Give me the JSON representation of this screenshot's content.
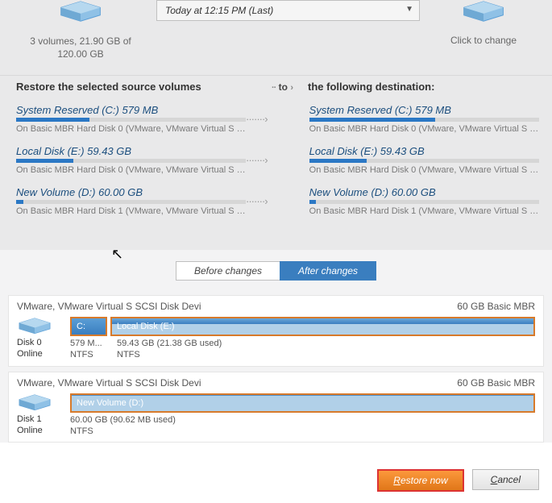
{
  "top": {
    "source_summary": "3 volumes, 21.90 GB of 120.00 GB",
    "snapshot_label": "Today at 12:15 PM (Last)",
    "dest_label": "Click to change"
  },
  "mapping": {
    "left_title": "Restore the selected source volumes",
    "mid_label": "to",
    "right_title": "the following destination:",
    "rows": [
      {
        "title": "System Reserved (C:) 579 MB",
        "sub": "On Basic MBR Hard Disk 0 (VMware, VMware Virtual S SCSI Di...",
        "fill": 32,
        "r_title": "System Reserved (C:) 579 MB",
        "r_sub": "On Basic MBR Hard Disk 0 (VMware, VMware Virtual S SCSI Di...",
        "r_fill": 55
      },
      {
        "title": "Local Disk (E:) 59.43 GB",
        "sub": "On Basic MBR Hard Disk 0 (VMware, VMware Virtual S SCSI Di...",
        "fill": 25,
        "r_title": "Local Disk (E:) 59.43 GB",
        "r_sub": "On Basic MBR Hard Disk 0 (VMware, VMware Virtual S SCSI Di...",
        "r_fill": 25
      },
      {
        "title": "New Volume (D:) 60.00 GB",
        "sub": "On Basic MBR Hard Disk 1 (VMware, VMware Virtual S SCSI Di...",
        "fill": 3,
        "r_title": "New Volume (D:) 60.00 GB",
        "r_sub": "On Basic MBR Hard Disk 1 (VMware, VMware Virtual S SCSI Dis...",
        "r_fill": 3
      }
    ]
  },
  "tabs": {
    "before": "Before changes",
    "after": "After changes"
  },
  "disks": [
    {
      "title": "VMware, VMware Virtual S SCSI Disk Devi",
      "summary": "60 GB Basic MBR",
      "id_label": "Disk 0",
      "status": "Online",
      "parts": [
        {
          "letter": "C:",
          "meta1": "579 M...",
          "meta2": "NTFS"
        },
        {
          "letter": "Local Disk (E:)",
          "meta1": "59.43 GB (21.38 GB used)",
          "meta2": "NTFS"
        }
      ]
    },
    {
      "title": "VMware, VMware Virtual S SCSI Disk Devi",
      "summary": "60 GB Basic MBR",
      "id_label": "Disk 1",
      "status": "Online",
      "parts": [
        {
          "letter": "New Volume (D:)",
          "meta1": "60.00 GB (90.62 MB used)",
          "meta2": "NTFS"
        }
      ]
    }
  ],
  "footer": {
    "restore": "Restore now",
    "cancel": "Cancel"
  },
  "colors": {
    "accent": "#3a7ebf",
    "primary_btn": "#e07719",
    "highlight_border": "#d77a2b"
  }
}
